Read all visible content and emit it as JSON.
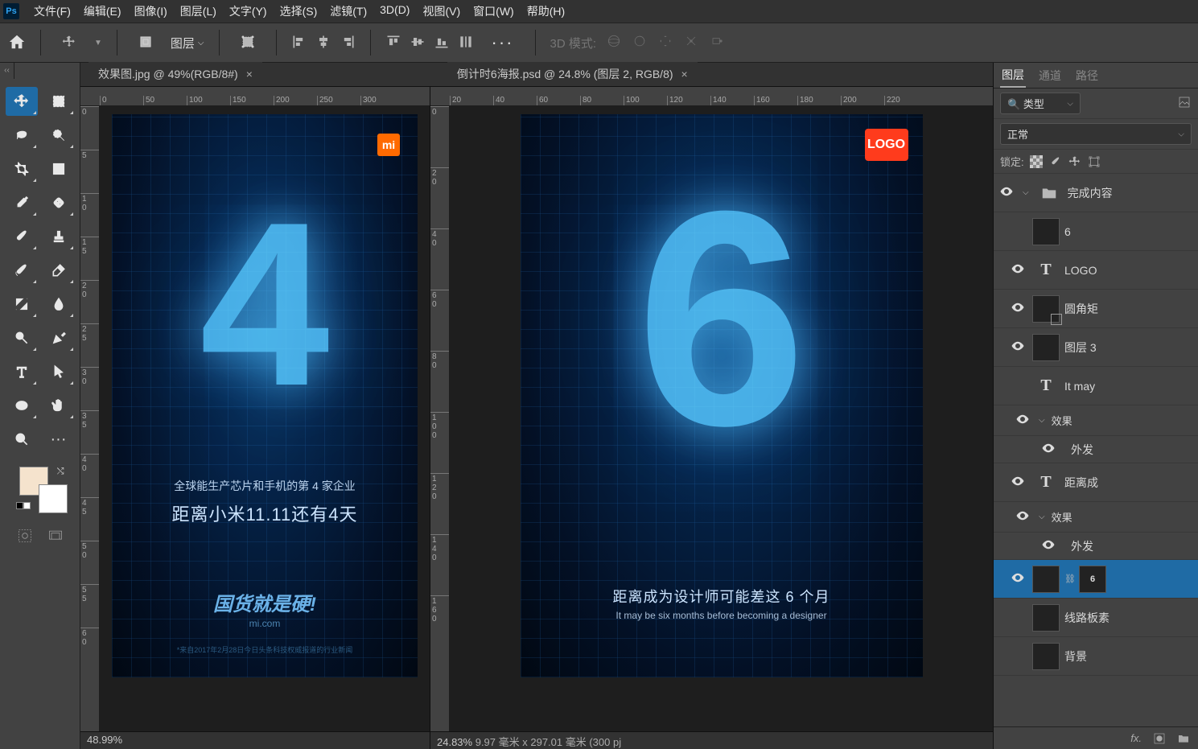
{
  "menubar": {
    "items": [
      "文件(F)",
      "编辑(E)",
      "图像(I)",
      "图层(L)",
      "文字(Y)",
      "选择(S)",
      "滤镜(T)",
      "3D(D)",
      "视图(V)",
      "窗口(W)",
      "帮助(H)"
    ]
  },
  "optionsbar": {
    "layer_label": "图层",
    "threeD_label": "3D 模式:"
  },
  "tabs": {
    "left": {
      "title": "效果图.jpg @ 49%(RGB/8#)"
    },
    "right": {
      "title": "倒计时6海报.psd @ 24.8% (图层 2, RGB/8)"
    }
  },
  "ruler_h_left": [
    "0",
    "50",
    "100",
    "150",
    "200",
    "250",
    "300"
  ],
  "ruler_h_right": [
    "20",
    "40",
    "60",
    "80",
    "100",
    "120",
    "140",
    "160",
    "180",
    "200",
    "220"
  ],
  "ruler_v_left": [
    "0",
    "5",
    "0",
    "5",
    "0",
    "5",
    "0",
    "5",
    "0",
    "5",
    "3",
    "4",
    "4",
    "5",
    "5",
    "0",
    "5",
    "0"
  ],
  "ruler_v_left_actual": [
    "0",
    "5",
    "1",
    "0",
    "1",
    "5",
    "2",
    "0",
    "2",
    "5",
    "3",
    "0",
    "3",
    "5",
    "4",
    "0",
    "4",
    "5",
    "5",
    "0",
    "5",
    "5",
    "6",
    "0"
  ],
  "ruler_v_right": [
    "0",
    "2",
    "0",
    "4",
    "0",
    "6",
    "0",
    "8",
    "0",
    "1",
    "0",
    "0",
    "1",
    "2",
    "0",
    "1",
    "4",
    "0"
  ],
  "poster1": {
    "logo": "mi",
    "number": "4",
    "sub": "全球能生产芯片和手机的第 4 家企业",
    "main": "距离小米11.11还有4天",
    "brand": "国货就是硬!",
    "site": "mi.com",
    "fine": "*来自2017年2月28日今日头条科技权威报道的行业新闻"
  },
  "poster2": {
    "logo": "LOGO",
    "number": "6",
    "main": "距离成为设计师可能差这 6 个月",
    "en": "It may be six months before becoming a designer"
  },
  "status": {
    "left": "48.99%",
    "right_zoom": "24.83%",
    "right_dims": "9.97 毫米 x 297.01 毫米 (300 pj"
  },
  "panels": {
    "tabs": [
      "图层",
      "通道",
      "路径"
    ],
    "filter_label": "类型",
    "blend_mode": "正常",
    "lock_label": "锁定:",
    "layers": [
      {
        "vis": true,
        "type": "folder",
        "name": "完成内容",
        "indent": 0,
        "expanded": true
      },
      {
        "vis": false,
        "type": "img",
        "name": "6",
        "indent": 1,
        "thumbClass": "bluethumb"
      },
      {
        "vis": true,
        "type": "T",
        "name": "LOGO",
        "indent": 1
      },
      {
        "vis": true,
        "type": "shape",
        "name": "圆角矩",
        "indent": 1,
        "thumbClass": "redthumb"
      },
      {
        "vis": true,
        "type": "img",
        "name": "图层 3",
        "indent": 1,
        "thumbClass": "checker"
      },
      {
        "vis": null,
        "type": "T",
        "name": "It may",
        "indent": 1
      },
      {
        "vis": true,
        "type": "fx",
        "name": "效果",
        "indent": 2
      },
      {
        "vis": true,
        "type": "fxsub",
        "name": "外发",
        "indent": 3
      },
      {
        "vis": true,
        "type": "T",
        "name": "距离成",
        "indent": 1
      },
      {
        "vis": true,
        "type": "fx",
        "name": "效果",
        "indent": 2
      },
      {
        "vis": true,
        "type": "fxsub",
        "name": "外发",
        "indent": 3
      },
      {
        "vis": true,
        "type": "masked",
        "name": "",
        "indent": 1,
        "selected": true,
        "thumbClass": "blackthumb",
        "link": "6"
      },
      {
        "vis": null,
        "type": "img",
        "name": "线路板素",
        "indent": 1,
        "thumbClass": "bluethumb"
      },
      {
        "vis": null,
        "type": "img",
        "name": "背景",
        "indent": 1,
        "thumbClass": "whitethumb"
      }
    ],
    "footer_fx": "fx."
  }
}
